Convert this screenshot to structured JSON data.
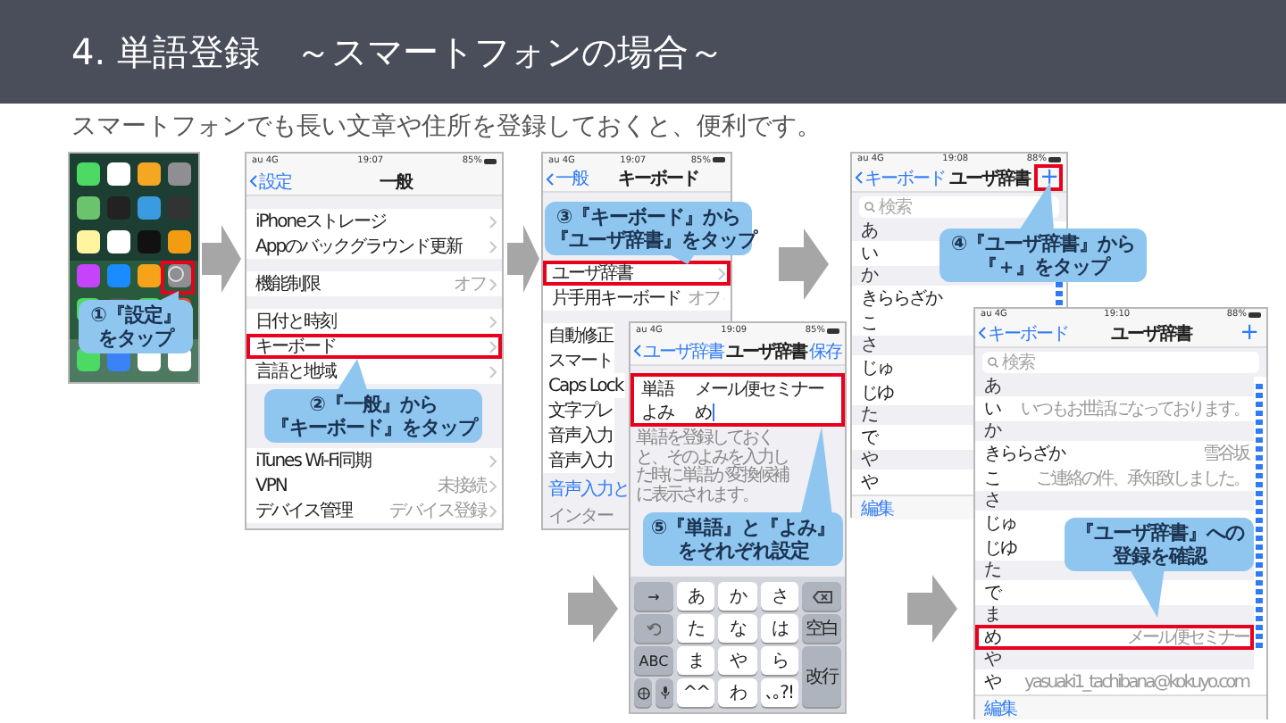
{
  "header": {
    "title": "4. 単語登録　～スマートフォンの場合～"
  },
  "subtitle": "スマートフォンでも長い文章や住所を登録しておくと、便利です。",
  "phones": [
    {
      "kind": "home",
      "callout": [
        "①『設定』",
        "をタップ"
      ]
    },
    {
      "kind": "settings",
      "status": {
        "carrier": "au 4G",
        "time": "19:07",
        "battery": "85%"
      },
      "nav": {
        "back": "設定",
        "title": "一般"
      },
      "groups": [
        {
          "rows": [
            {
              "label": "iPhoneストレージ",
              "highlighted": false
            },
            {
              "label": "Appのバックグラウンド更新",
              "highlighted": false
            }
          ]
        },
        {
          "rows": [
            {
              "label": "機能制限",
              "value": "オフ",
              "highlighted": false
            }
          ]
        },
        {
          "rows": [
            {
              "label": "日付と時刻",
              "highlighted": false
            },
            {
              "label": "キーボード",
              "highlighted": true
            },
            {
              "label": "言語と地域",
              "highlighted": false
            }
          ]
        },
        {
          "rows": [
            {
              "label": "iTunes Wi-Fi同期",
              "highlighted": false
            },
            {
              "label": "VPN",
              "value": "未接続",
              "highlighted": false
            },
            {
              "label": "デバイス管理",
              "value": "デバイス登録",
              "highlighted": false
            }
          ]
        }
      ],
      "callout": [
        "②『一般』から",
        "『キーボード』をタップ"
      ]
    },
    {
      "kind": "settings",
      "status": {
        "carrier": "au 4G",
        "time": "19:07",
        "battery": "85%"
      },
      "nav": {
        "back": "一般",
        "title": "キーボード"
      },
      "groups": [
        {
          "rows": [
            {
              "label": "ユーザ辞書",
              "highlighted": true
            },
            {
              "label": "片手用キーボード",
              "value": "オフ",
              "highlighted": false
            }
          ]
        },
        {
          "rows": [
            {
              "label": "自動修正",
              "highlighted": false
            },
            {
              "label": "スマート",
              "highlighted": false
            },
            {
              "label": "Caps Lock",
              "highlighted": false
            },
            {
              "label": "文字プレ",
              "highlighted": false
            },
            {
              "label": "音声入力",
              "highlighted": false
            },
            {
              "label": "音声入力",
              "highlighted": false
            }
          ]
        }
      ],
      "footer": {
        "link": "音声入力と",
        "note": "インター"
      },
      "callout": [
        "③『キーボード』から",
        "『ユーザ辞書』をタップ"
      ]
    },
    {
      "kind": "dictionary",
      "status": {
        "carrier": "au 4G",
        "time": "19:08",
        "battery": "88%"
      },
      "nav": {
        "back": "キーボード",
        "title": "ユーザ辞書",
        "add": {
          "label": "+",
          "highlighted": true
        }
      },
      "search": {
        "placeholder": "検索"
      },
      "entries": [
        {
          "kind": "header",
          "label": "あ"
        },
        {
          "kind": "entry",
          "label": "い",
          "highlighted": false
        },
        {
          "kind": "header",
          "label": "か"
        },
        {
          "kind": "entry",
          "label": "きららざか",
          "highlighted": false
        },
        {
          "kind": "entry",
          "label": "こ",
          "highlighted": false
        },
        {
          "kind": "header",
          "label": "さ"
        },
        {
          "kind": "entry",
          "label": "じゅ",
          "highlighted": false
        },
        {
          "kind": "entry",
          "label": "じゆ",
          "highlighted": false
        },
        {
          "kind": "header",
          "label": "た"
        },
        {
          "kind": "entry",
          "label": "で",
          "highlighted": false
        },
        {
          "kind": "header",
          "label": "や"
        },
        {
          "kind": "entry",
          "label": "や",
          "highlighted": false
        }
      ],
      "edit": "編集",
      "callout": [
        "④『ユーザ辞書』から",
        "『＋』をタップ"
      ]
    },
    {
      "kind": "form",
      "status": {
        "carrier": "au 4G",
        "time": "19:09",
        "battery": "85%"
      },
      "nav": {
        "back": "ユーザ辞書",
        "title": "ユーザ辞書",
        "action": "保存"
      },
      "fields": [
        {
          "label": "単語",
          "value": "メール便セミナー"
        },
        {
          "label": "よみ",
          "value": "め"
        }
      ],
      "highlighted": true,
      "note": "単語を登録しておくと、そのよみを入力した時に単語が変換候補に表示されます。",
      "keys": [
        {
          "kind": "side",
          "label": "→"
        },
        {
          "kind": "char",
          "label": "あ"
        },
        {
          "kind": "char",
          "label": "か"
        },
        {
          "kind": "char",
          "label": "さ"
        },
        {
          "kind": "delete"
        },
        {
          "kind": "undo"
        },
        {
          "kind": "char",
          "label": "た"
        },
        {
          "kind": "char",
          "label": "な"
        },
        {
          "kind": "char",
          "label": "は"
        },
        {
          "kind": "action",
          "label": "空白"
        },
        {
          "kind": "side",
          "label": "ABC"
        },
        {
          "kind": "char",
          "label": "ま"
        },
        {
          "kind": "char",
          "label": "や"
        },
        {
          "kind": "char",
          "label": "ら"
        },
        {
          "kind": "enter",
          "label": "改行"
        },
        {
          "kind": "globe"
        },
        {
          "kind": "mic"
        },
        {
          "kind": "char",
          "label": "^^"
        },
        {
          "kind": "char",
          "label": "わ"
        },
        {
          "kind": "char",
          "label": "､｡?!"
        }
      ],
      "callout": [
        "⑤『単語』と『よみ』",
        "をそれぞれ設定"
      ]
    },
    {
      "kind": "dictionary",
      "status": {
        "carrier": "au 4G",
        "time": "19:10",
        "battery": "88%"
      },
      "nav": {
        "back": "キーボード",
        "title": "ユーザ辞書",
        "add": {
          "label": "+",
          "highlighted": false
        }
      },
      "search": {
        "placeholder": "検索"
      },
      "entries": [
        {
          "kind": "header",
          "label": "あ"
        },
        {
          "kind": "entry",
          "label": "い",
          "value": "いつもお世話になっております。",
          "highlighted": false
        },
        {
          "kind": "header",
          "label": "か"
        },
        {
          "kind": "entry",
          "label": "きららざか",
          "value": "雪谷坂",
          "highlighted": false
        },
        {
          "kind": "entry",
          "label": "こ",
          "value": "ご連絡の件、承知致しました。",
          "highlighted": false
        },
        {
          "kind": "header",
          "label": "さ"
        },
        {
          "kind": "entry",
          "label": "じゅ",
          "highlighted": false
        },
        {
          "kind": "entry",
          "label": "じゆ",
          "highlighted": false
        },
        {
          "kind": "header",
          "label": "た"
        },
        {
          "kind": "entry",
          "label": "で",
          "highlighted": false
        },
        {
          "kind": "header",
          "label": "ま"
        },
        {
          "kind": "entry",
          "label": "め",
          "value": "メール便セミナー",
          "highlighted": true
        },
        {
          "kind": "header",
          "label": "や"
        },
        {
          "kind": "entry",
          "label": "や",
          "value": "yasuaki1_tachibana@kokuyo.com",
          "highlighted": false
        }
      ],
      "edit": "編集",
      "callout": [
        "『ユーザ辞書』への",
        "登録を確認"
      ]
    }
  ]
}
